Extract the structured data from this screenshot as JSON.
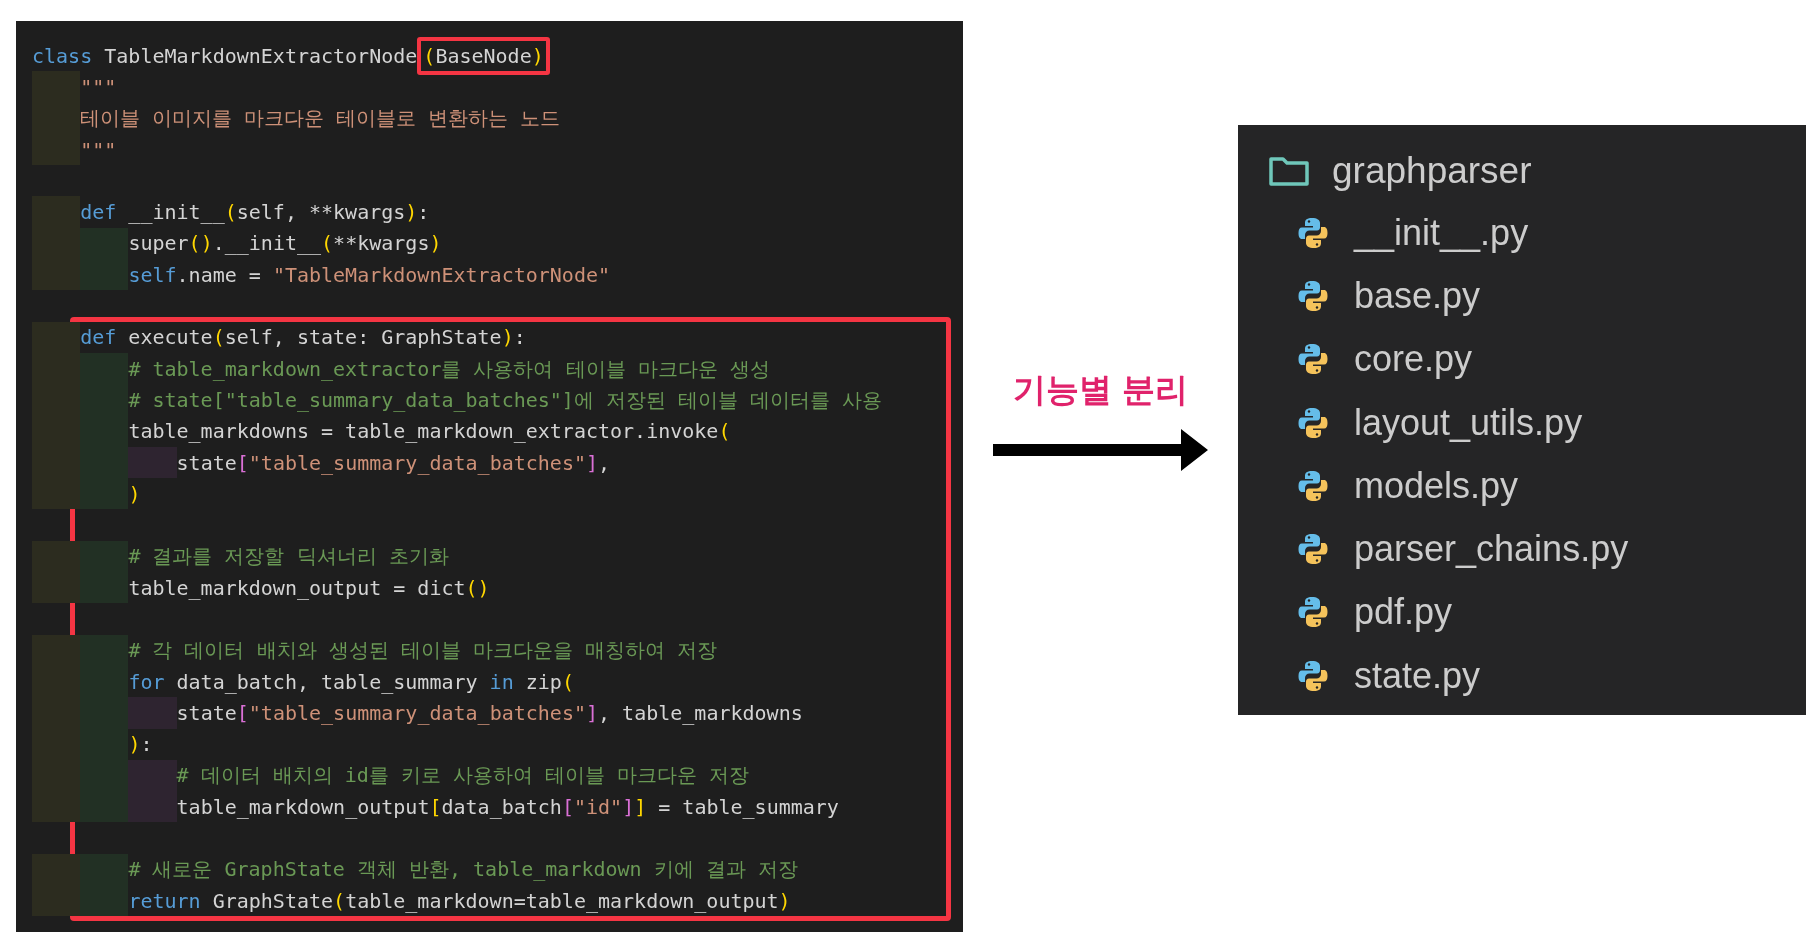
{
  "code_editor": {
    "lines": [
      {
        "kind": "code",
        "tokens": [
          {
            "kind": "keyword",
            "text": "class"
          },
          {
            "kind": "plain",
            "text": " TableMarkdownExtractorNode"
          },
          {
            "kind": "paren",
            "text": "(",
            "boxed": true
          },
          {
            "kind": "plain",
            "text": "BaseNode",
            "boxed": true
          },
          {
            "kind": "paren",
            "text": ")",
            "boxed": true
          }
        ],
        "children": [
          {
            "kind": "code",
            "tokens": [
              {
                "kind": "docstring",
                "text": "\"\"\""
              }
            ]
          },
          {
            "kind": "code",
            "tokens": [
              {
                "kind": "docstring",
                "text": "테이블 이미지를 마크다운 테이블로 변환하는 노드"
              }
            ]
          },
          {
            "kind": "code",
            "tokens": [
              {
                "kind": "docstring",
                "text": "\"\"\""
              }
            ]
          },
          {
            "kind": "blank"
          },
          {
            "kind": "code",
            "tokens": [
              {
                "kind": "keyword",
                "text": "def"
              },
              {
                "kind": "plain",
                "text": " __init__"
              },
              {
                "kind": "paren",
                "text": "("
              },
              {
                "kind": "plain",
                "text": "self, **kwargs"
              },
              {
                "kind": "paren",
                "text": ")"
              },
              {
                "kind": "plain",
                "text": ":"
              }
            ],
            "children": [
              {
                "kind": "code",
                "tokens": [
                  {
                    "kind": "plain",
                    "text": "super"
                  },
                  {
                    "kind": "paren",
                    "text": "()"
                  },
                  {
                    "kind": "plain",
                    "text": ".__init__"
                  },
                  {
                    "kind": "paren",
                    "text": "("
                  },
                  {
                    "kind": "plain",
                    "text": "**kwargs"
                  },
                  {
                    "kind": "paren",
                    "text": ")"
                  }
                ]
              },
              {
                "kind": "code",
                "tokens": [
                  {
                    "kind": "keyword",
                    "text": "self"
                  },
                  {
                    "kind": "plain",
                    "text": ".name = "
                  },
                  {
                    "kind": "string",
                    "text": "\"TableMarkdownExtractorNode\""
                  }
                ]
              }
            ]
          },
          {
            "kind": "blank"
          },
          {
            "kind": "code",
            "boxed": true,
            "tokens": [
              {
                "kind": "keyword",
                "text": "def"
              },
              {
                "kind": "plain",
                "text": " execute"
              },
              {
                "kind": "paren",
                "text": "("
              },
              {
                "kind": "plain",
                "text": "self, state: GraphState"
              },
              {
                "kind": "paren",
                "text": ")"
              },
              {
                "kind": "plain",
                "text": ":"
              }
            ],
            "children": [
              {
                "kind": "code",
                "tokens": [
                  {
                    "kind": "comment",
                    "text": "# table_markdown_extractor를 사용하여 테이블 마크다운 생성"
                  }
                ]
              },
              {
                "kind": "code",
                "tokens": [
                  {
                    "kind": "comment",
                    "text": "# state[\"table_summary_data_batches\"]에 저장된 테이블 데이터를 사용"
                  }
                ]
              },
              {
                "kind": "code",
                "tokens": [
                  {
                    "kind": "plain",
                    "text": "table_markdowns = table_markdown_extractor.invoke"
                  },
                  {
                    "kind": "paren",
                    "text": "("
                  }
                ],
                "children": [
                  {
                    "kind": "code",
                    "tokens": [
                      {
                        "kind": "plain",
                        "text": "state"
                      },
                      {
                        "kind": "bracket",
                        "text": "["
                      },
                      {
                        "kind": "string",
                        "text": "\"table_summary_data_batches\""
                      },
                      {
                        "kind": "bracket",
                        "text": "]"
                      },
                      {
                        "kind": "plain",
                        "text": ","
                      }
                    ]
                  }
                ]
              },
              {
                "kind": "code",
                "tokens": [
                  {
                    "kind": "paren",
                    "text": ")"
                  }
                ]
              },
              {
                "kind": "blank"
              },
              {
                "kind": "code",
                "tokens": [
                  {
                    "kind": "comment",
                    "text": "# 결과를 저장할 딕셔너리 초기화"
                  }
                ]
              },
              {
                "kind": "code",
                "tokens": [
                  {
                    "kind": "plain",
                    "text": "table_markdown_output = dict"
                  },
                  {
                    "kind": "paren",
                    "text": "()"
                  }
                ]
              },
              {
                "kind": "blank"
              },
              {
                "kind": "code",
                "tokens": [
                  {
                    "kind": "comment",
                    "text": "# 각 데이터 배치와 생성된 테이블 마크다운을 매칭하여 저장"
                  }
                ]
              },
              {
                "kind": "code",
                "tokens": [
                  {
                    "kind": "keyword",
                    "text": "for"
                  },
                  {
                    "kind": "plain",
                    "text": " data_batch, table_summary "
                  },
                  {
                    "kind": "keyword",
                    "text": "in"
                  },
                  {
                    "kind": "plain",
                    "text": " zip"
                  },
                  {
                    "kind": "paren",
                    "text": "("
                  }
                ],
                "children": [
                  {
                    "kind": "code",
                    "tokens": [
                      {
                        "kind": "plain",
                        "text": "state"
                      },
                      {
                        "kind": "bracket",
                        "text": "["
                      },
                      {
                        "kind": "string",
                        "text": "\"table_summary_data_batches\""
                      },
                      {
                        "kind": "bracket",
                        "text": "]"
                      },
                      {
                        "kind": "plain",
                        "text": ", table_markdowns"
                      }
                    ]
                  }
                ]
              },
              {
                "kind": "code",
                "tokens": [
                  {
                    "kind": "paren",
                    "text": ")"
                  },
                  {
                    "kind": "plain",
                    "text": ":"
                  }
                ],
                "children": [
                  {
                    "kind": "code",
                    "tokens": [
                      {
                        "kind": "comment",
                        "text": "# 데이터 배치의 id를 키로 사용하여 테이블 마크다운 저장"
                      }
                    ]
                  },
                  {
                    "kind": "code",
                    "tokens": [
                      {
                        "kind": "plain",
                        "text": "table_markdown_output"
                      },
                      {
                        "kind": "paren",
                        "text": "["
                      },
                      {
                        "kind": "plain",
                        "text": "data_batch"
                      },
                      {
                        "kind": "bracket",
                        "text": "["
                      },
                      {
                        "kind": "string",
                        "text": "\"id\""
                      },
                      {
                        "kind": "bracket",
                        "text": "]"
                      },
                      {
                        "kind": "paren",
                        "text": "]"
                      },
                      {
                        "kind": "plain",
                        "text": " = table_summary"
                      }
                    ]
                  }
                ]
              },
              {
                "kind": "blank"
              },
              {
                "kind": "code",
                "tokens": [
                  {
                    "kind": "comment",
                    "text": "# 새로운 GraphState 객체 반환, table_markdown 키에 결과 저장"
                  }
                ]
              },
              {
                "kind": "code",
                "tokens": [
                  {
                    "kind": "keyword",
                    "text": "return"
                  },
                  {
                    "kind": "plain",
                    "text": " GraphState"
                  },
                  {
                    "kind": "paren",
                    "text": "("
                  },
                  {
                    "kind": "plain",
                    "text": "table_markdown=table_markdown_output"
                  },
                  {
                    "kind": "paren",
                    "text": ")"
                  }
                ]
              }
            ]
          }
        ]
      }
    ]
  },
  "arrow": {
    "label": "기능별 분리"
  },
  "file_tree": {
    "folder": {
      "name": "graphparser",
      "children": [
        {
          "name": "__init__.py"
        },
        {
          "name": "base.py"
        },
        {
          "name": "core.py"
        },
        {
          "name": "layout_utils.py"
        },
        {
          "name": "models.py"
        },
        {
          "name": "parser_chains.py"
        },
        {
          "name": "pdf.py"
        },
        {
          "name": "state.py"
        }
      ]
    }
  }
}
